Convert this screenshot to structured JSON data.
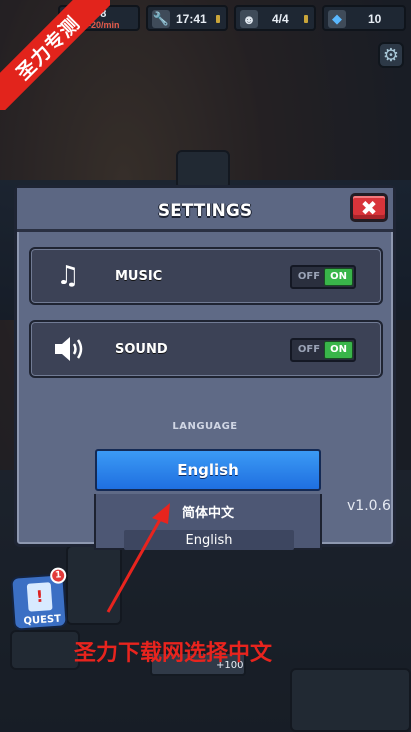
{
  "topbar": {
    "resources": [
      {
        "icon": "radiation-icon",
        "value": "898",
        "sub": "-20/min"
      },
      {
        "icon": "wrench-icon",
        "value": "17:41",
        "sub": ""
      },
      {
        "icon": "survivor-icon",
        "value": "4/4",
        "sub": ""
      },
      {
        "icon": "gem-icon",
        "value": "10",
        "sub": ""
      }
    ]
  },
  "promo": {
    "ribbon_text": "圣力专测"
  },
  "settings": {
    "title": "SETTINGS",
    "close_symbol": "✖",
    "music": {
      "label": "MUSIC",
      "off": "OFF",
      "on": "ON",
      "enabled": true
    },
    "sound": {
      "label": "SOUND",
      "off": "OFF",
      "on": "ON",
      "enabled": true
    },
    "language_label": "LANGUAGE",
    "selected_language": "English",
    "options": [
      "简体中文",
      "English"
    ],
    "version": "v1.0.6"
  },
  "quest": {
    "label": "QUEST",
    "badge": "1"
  },
  "reward": {
    "amount": "+100"
  },
  "annotation": {
    "caption": "圣力下载网选择中文"
  },
  "colors": {
    "accent_blue": "#1f6fe0",
    "toggle_on": "#39b54a",
    "close_red": "#d8343a",
    "annotation_red": "#e8241e",
    "panel": "#5f6a86"
  }
}
